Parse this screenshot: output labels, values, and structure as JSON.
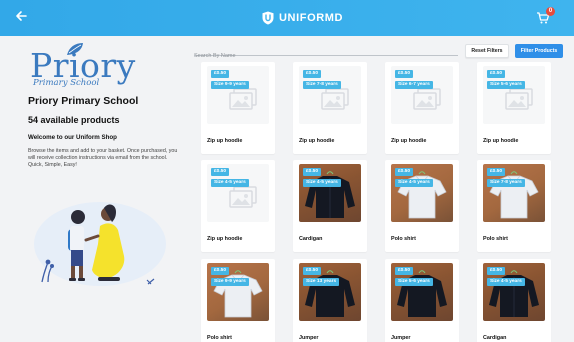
{
  "header": {
    "brand": "UNIFORMD",
    "cart_count": "0",
    "icons": {
      "back": "arrow-left-icon",
      "logo": "shield-icon",
      "cart": "cart-icon"
    },
    "colors": {
      "bar": "#3fb4ee",
      "badge": "#e74c3c"
    }
  },
  "school": {
    "logo_title": "Priory",
    "logo_subtitle": "Primary School",
    "name": "Priory Primary School",
    "products_count": "54 available products",
    "welcome": "Welcome to our Uniform Shop",
    "description": "Browse the items and add to your basket. Once purchased, you will receive collection instructions via email from the school. Quick, Simple, Easy!"
  },
  "toolbar": {
    "search_placeholder": "Search By Name",
    "reset_label": "Reset Filters",
    "filter_label": "Filter Products",
    "colors": {
      "filter": "#2f8fe8",
      "tag": "#45b6e5"
    }
  },
  "products": [
    {
      "name": "Zip up hoodie",
      "price": "£0.50",
      "size": "Size 9-9 years",
      "image": "placeholder"
    },
    {
      "name": "Zip up hoodie",
      "price": "£0.50",
      "size": "Size 7-8 years",
      "image": "placeholder"
    },
    {
      "name": "Zip up hoodie",
      "price": "£0.50",
      "size": "Size 6-7 years",
      "image": "placeholder"
    },
    {
      "name": "Zip up hoodie",
      "price": "£0.50",
      "size": "Size 5-6 years",
      "image": "placeholder"
    },
    {
      "name": "Zip up hoodie",
      "price": "£0.50",
      "size": "Size 4-5 years",
      "image": "placeholder"
    },
    {
      "name": "Cardigan",
      "price": "£0.50",
      "size": "Size 4-5 years",
      "image": "cardigan"
    },
    {
      "name": "Polo shirt",
      "price": "£0.50",
      "size": "Size 4-5 years",
      "image": "polo"
    },
    {
      "name": "Polo shirt",
      "price": "£0.50",
      "size": "Size 7-8 years",
      "image": "polo"
    },
    {
      "name": "Polo shirt",
      "price": "£0.50",
      "size": "Size 9-9 years",
      "image": "polo"
    },
    {
      "name": "Jumper",
      "price": "£0.50",
      "size": "Size 13 years",
      "image": "jumper"
    },
    {
      "name": "Jumper",
      "price": "£0.50",
      "size": "Size 5-6 years",
      "image": "jumper"
    },
    {
      "name": "Cardigan",
      "price": "£0.50",
      "size": "Size 4-5 years",
      "image": "cardigan"
    }
  ]
}
